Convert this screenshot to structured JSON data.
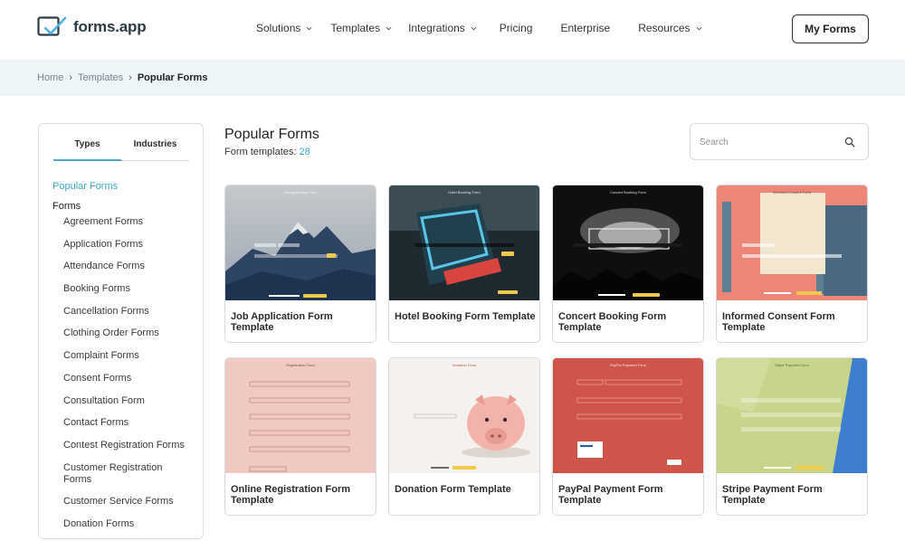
{
  "header": {
    "logo_text": "forms.app",
    "nav": [
      {
        "label": "Solutions",
        "has_dropdown": true
      },
      {
        "label": "Templates",
        "has_dropdown": true
      },
      {
        "label": "Integrations",
        "has_dropdown": true
      },
      {
        "label": "Pricing",
        "has_dropdown": false
      },
      {
        "label": "Enterprise",
        "has_dropdown": false
      },
      {
        "label": "Resources",
        "has_dropdown": true
      }
    ],
    "my_forms_label": "My Forms"
  },
  "breadcrumb": {
    "items": [
      "Home",
      "Templates",
      "Popular Forms"
    ]
  },
  "sidebar": {
    "tabs": [
      "Types",
      "Industries"
    ],
    "popular": "Popular Forms",
    "section": "Forms",
    "items": [
      "Agreement Forms",
      "Application Forms",
      "Attendance Forms",
      "Booking Forms",
      "Cancellation Forms",
      "Clothing Order Forms",
      "Complaint Forms",
      "Consent Forms",
      "Consultation Form",
      "Contact Forms",
      "Contest Registration Forms",
      "Customer Registration Forms",
      "Customer Service Forms",
      "Donation Forms"
    ]
  },
  "main": {
    "title": "Popular Forms",
    "count_label": "Form templates:",
    "count_value": "28",
    "search_placeholder": "Search",
    "cards": [
      {
        "label": "Job Application Form Template",
        "thumb_title": "Job Application Form"
      },
      {
        "label": "Hotel Booking Form Template",
        "thumb_title": "Hotel Booking Form"
      },
      {
        "label": "Concert Booking Form Template",
        "thumb_title": "Concert Booking Form"
      },
      {
        "label": "Informed Consent Form Template",
        "thumb_title": "Informed Consent Form"
      },
      {
        "label": "Online Registration Form Template",
        "thumb_title": "Registration Form"
      },
      {
        "label": "Donation Form Template",
        "thumb_title": "Donation Form"
      },
      {
        "label": "PayPal Payment Form Template",
        "thumb_title": "PayPal Payment Form"
      },
      {
        "label": "Stripe Payment Form Template",
        "thumb_title": "Stripe Payment Form"
      }
    ]
  },
  "colors": {
    "accent": "#3ba6cc",
    "crumb_bg": "#eef5f8"
  }
}
